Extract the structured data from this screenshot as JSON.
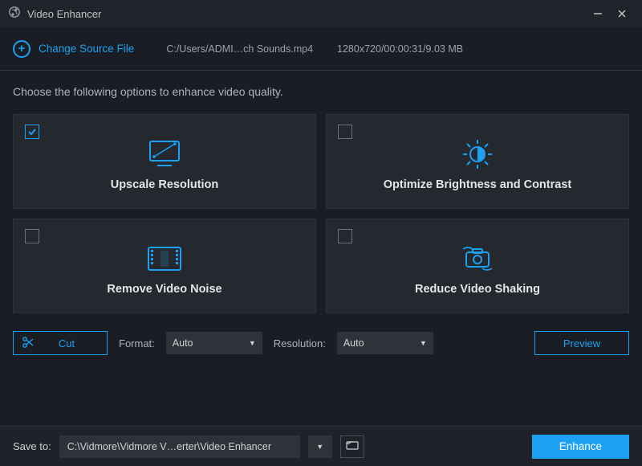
{
  "titlebar": {
    "title": "Video Enhancer"
  },
  "source": {
    "button": "Change Source File",
    "path": "C:/Users/ADMI…ch Sounds.mp4",
    "meta": "1280x720/00:00:31/9.03 MB"
  },
  "prompt": "Choose the following options to enhance video quality.",
  "cards": {
    "upscale": {
      "label": "Upscale Resolution",
      "checked": true
    },
    "brightness": {
      "label": "Optimize Brightness and Contrast",
      "checked": false
    },
    "noise": {
      "label": "Remove Video Noise",
      "checked": false
    },
    "shaking": {
      "label": "Reduce Video Shaking",
      "checked": false
    }
  },
  "controls": {
    "cut": "Cut",
    "format_label": "Format:",
    "format_value": "Auto",
    "resolution_label": "Resolution:",
    "resolution_value": "Auto",
    "preview": "Preview"
  },
  "footer": {
    "save_label": "Save to:",
    "save_path": "C:\\Vidmore\\Vidmore V…erter\\Video Enhancer",
    "enhance": "Enhance"
  }
}
